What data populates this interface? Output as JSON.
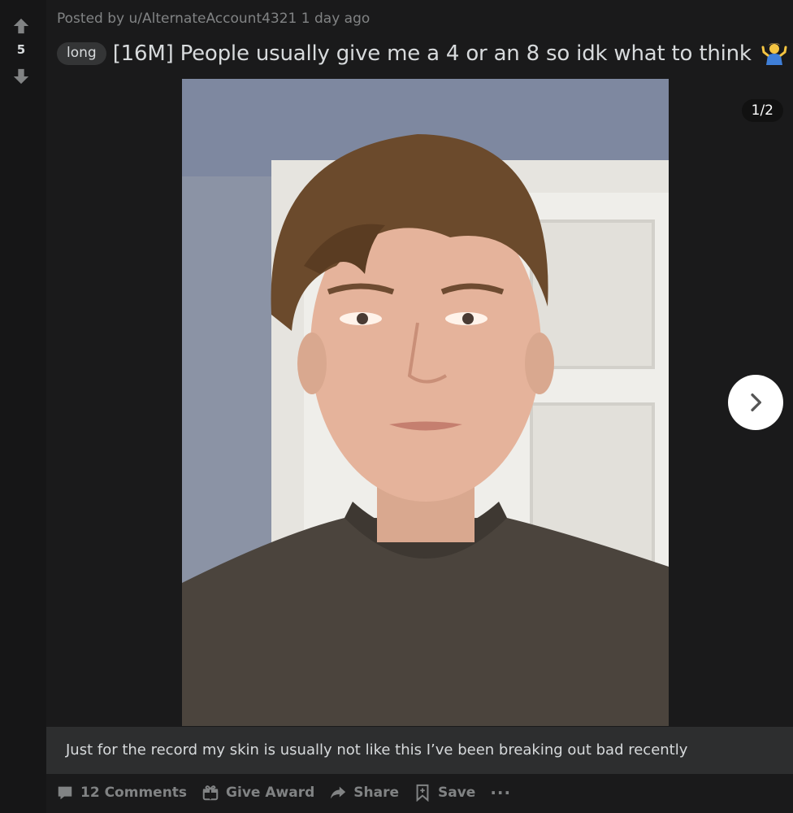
{
  "vote": {
    "score": "5"
  },
  "post": {
    "posted_by": "Posted by u/AlternateAccount4321 1 day ago",
    "flair": "long",
    "title": "[16M] People usually give me a 4 or an 8 so idk what to think",
    "media_counter": "1/2",
    "caption": "Just for the record my skin is usually not like this I’ve been breaking out bad recently"
  },
  "actions": {
    "comments": "12 Comments",
    "award": "Give Award",
    "share": "Share",
    "save": "Save",
    "more": "···"
  },
  "colors": {
    "background": "#1a1a1b",
    "text": "#d7dadc",
    "muted": "#818384",
    "caption_bg": "#2d2e2f"
  }
}
